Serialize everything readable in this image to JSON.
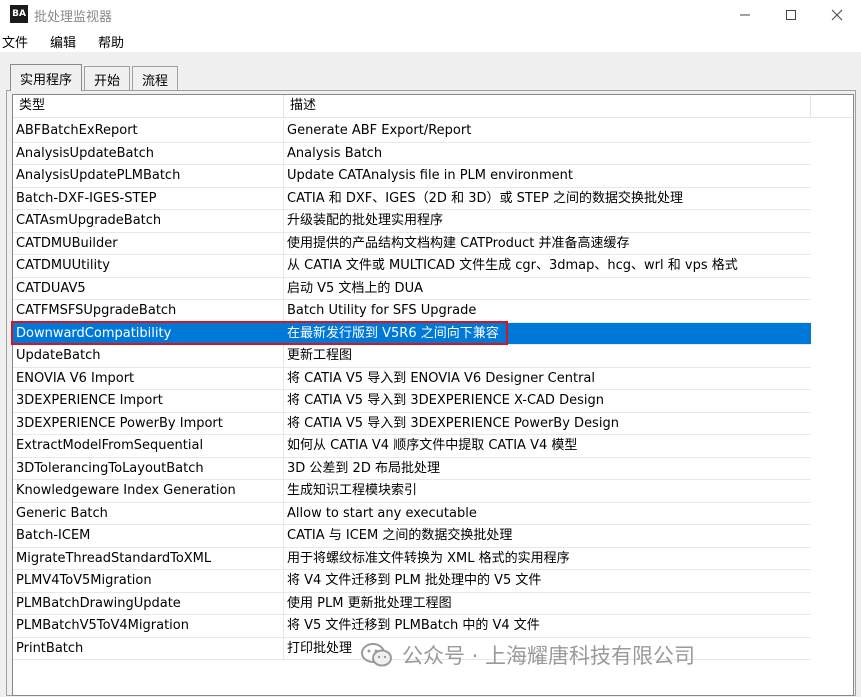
{
  "window": {
    "title": "批处理监视器",
    "icon_text": "BA",
    "controls": [
      "minimize",
      "maximize",
      "close"
    ]
  },
  "menu": [
    "文件",
    "编辑",
    "帮助"
  ],
  "tabs": [
    "实用程序",
    "开始",
    "流程"
  ],
  "active_tab": 0,
  "list": {
    "columns": [
      "类型",
      "描述"
    ],
    "selected_index": 9,
    "rows": [
      {
        "type": "ABFBatchExReport",
        "desc": "Generate ABF Export/Report"
      },
      {
        "type": "AnalysisUpdateBatch",
        "desc": "Analysis Batch"
      },
      {
        "type": "AnalysisUpdatePLMBatch",
        "desc": "Update CATAnalysis file in PLM environment"
      },
      {
        "type": "Batch-DXF-IGES-STEP",
        "desc": "CATIA 和 DXF、IGES（2D 和 3D）或 STEP 之间的数据交换批处理"
      },
      {
        "type": "CATAsmUpgradeBatch",
        "desc": "升级装配的批处理实用程序"
      },
      {
        "type": "CATDMUBuilder",
        "desc": "使用提供的产品结构文档构建 CATProduct 并准备高速缓存"
      },
      {
        "type": "CATDMUUtility",
        "desc": "从 CATIA 文件或 MULTICAD 文件生成 cgr、3dmap、hcg、wrl 和 vps 格式"
      },
      {
        "type": "CATDUAV5",
        "desc": "启动 V5 文档上的 DUA"
      },
      {
        "type": "CATFMSFSUpgradeBatch",
        "desc": "Batch Utility for SFS Upgrade"
      },
      {
        "type": "DownwardCompatibility",
        "desc": "在最新发行版到 V5R6 之间向下兼容"
      },
      {
        "type": "UpdateBatch",
        "desc": "更新工程图"
      },
      {
        "type": "ENOVIA V6 Import",
        "desc": "将 CATIA V5 导入到 ENOVIA V6 Designer Central"
      },
      {
        "type": "3DEXPERIENCE Import",
        "desc": "将 CATIA V5 导入到 3DEXPERIENCE X-CAD Design"
      },
      {
        "type": "3DEXPERIENCE PowerBy Import",
        "desc": "将 CATIA V5 导入到 3DEXPERIENCE PowerBy Design"
      },
      {
        "type": "ExtractModelFromSequential",
        "desc": "如何从 CATIA V4 顺序文件中提取 CATIA V4 模型"
      },
      {
        "type": "3DTolerancingToLayoutBatch",
        "desc": "3D 公差到 2D 布局批处理"
      },
      {
        "type": "Knowledgeware Index Generation",
        "desc": "生成知识工程模块索引"
      },
      {
        "type": "Generic Batch",
        "desc": "Allow to start any executable"
      },
      {
        "type": "Batch-ICEM",
        "desc": "CATIA 与 ICEM 之间的数据交换批处理"
      },
      {
        "type": "MigrateThreadStandardToXML",
        "desc": "用于将螺纹标准文件转换为 XML 格式的实用程序"
      },
      {
        "type": "PLMV4ToV5Migration",
        "desc": "将 V4 文件迁移到 PLM 批处理中的 V5 文件"
      },
      {
        "type": "PLMBatchDrawingUpdate",
        "desc": "使用 PLM 更新批处理工程图"
      },
      {
        "type": "PLMBatchV5ToV4Migration",
        "desc": "将 V5 文件迁移到 PLMBatch 中的 V4 文件"
      },
      {
        "type": "PrintBatch",
        "desc": "打印批处理"
      }
    ]
  },
  "watermark": "公众号 · 上海耀唐科技有限公司",
  "colors": {
    "selection": "#0078d7",
    "annotation_box": "#d8141c"
  }
}
